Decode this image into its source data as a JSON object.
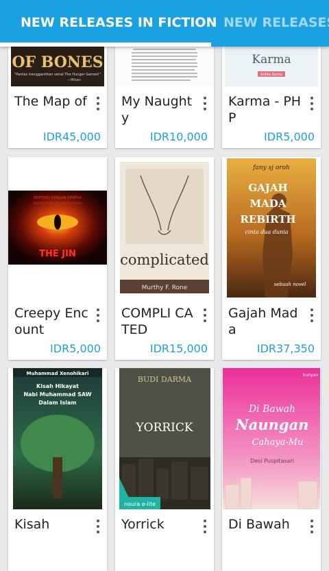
{
  "tabs": [
    {
      "label": "NEW RELEASES IN FICTION",
      "active": true
    },
    {
      "label": "NEW RELEASES",
      "active": false
    }
  ],
  "colors": {
    "accent": "#1aa1e1",
    "price": "#1aa1e1",
    "background": "#e9e9e9"
  },
  "books": [
    {
      "title": "The Map of",
      "price": "IDR45,000",
      "cover_text": [
        "OF BONES",
        "\"Pantas menggantikan serial The Hunger Games!\"",
        "—Mizan"
      ]
    },
    {
      "title": "My Naughty",
      "price": "IDR10,000",
      "cover_text": []
    },
    {
      "title": "Karma - PHP",
      "price": "IDR5,000",
      "cover_text": [
        "Karma",
        "Ardita Karisa"
      ]
    },
    {
      "title": "Creepy Encount",
      "price": "IDR5,000",
      "cover_text": [
        "BERTEMU DENGAN MEREKA",
        "JANGAN DIPANGGIL JANGAN DIRASA",
        "THE JIN"
      ]
    },
    {
      "title": "COMPLI CATED",
      "price": "IDR15,000",
      "cover_text": [
        "complicated",
        "Murthy F. Rone"
      ]
    },
    {
      "title": "Gajah Mada",
      "price": "IDR37,350",
      "cover_text": [
        "fany sj oroh",
        "GAJAH",
        "MADA",
        "REBIRTH",
        "cinta dua dunia",
        "sebuah novel"
      ]
    },
    {
      "title": "Kisah",
      "price": "",
      "cover_text": [
        "Muhammad Xenohikari",
        "Kisah Hikayat",
        "Nabi Muhammad SAW",
        "Dalam Islam"
      ]
    },
    {
      "title": "Yorrick",
      "price": "",
      "cover_text": [
        "BUDI DARMA",
        "YORRICK",
        "noura e-lite"
      ]
    },
    {
      "title": "Di Bawah",
      "price": "",
      "cover_text": [
        "Di Bawah",
        "Naungan",
        "Cahaya-Mu",
        "Desi Puspitasari",
        "bunyan"
      ]
    }
  ]
}
